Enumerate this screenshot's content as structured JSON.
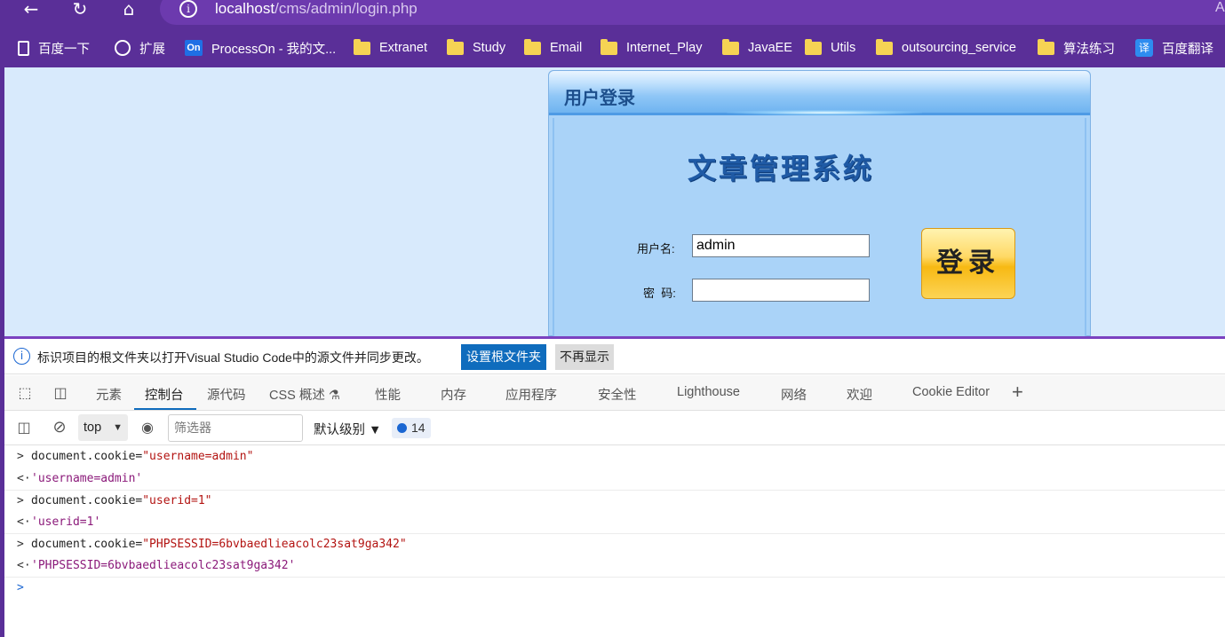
{
  "browser": {
    "url_host": "localhost",
    "url_path": "/cms/admin/login.php",
    "address_right_glyph": "A",
    "bookmarks": [
      {
        "label": "百度一下",
        "icon": "page-icon"
      },
      {
        "label": "扩展",
        "icon": "extensions-icon"
      },
      {
        "label": "ProcessOn - 我的文...",
        "icon": "processon-icon",
        "icon_text": "On"
      },
      {
        "label": "Extranet",
        "icon": "folder-icon"
      },
      {
        "label": "Study",
        "icon": "folder-icon"
      },
      {
        "label": "Email",
        "icon": "folder-icon"
      },
      {
        "label": "Internet_Play",
        "icon": "folder-icon"
      },
      {
        "label": "JavaEE",
        "icon": "folder-icon"
      },
      {
        "label": "Utils",
        "icon": "folder-icon"
      },
      {
        "label": "outsourcing_service",
        "icon": "folder-icon"
      },
      {
        "label": "算法练习",
        "icon": "folder-icon"
      },
      {
        "label": "百度翻译",
        "icon": "translate-icon",
        "icon_text": "译"
      }
    ]
  },
  "login_page": {
    "panel_title": "用户登录",
    "system_title": "文章管理系统",
    "username_label": "用户名:",
    "username_value": "admin",
    "password_label": "密  码:",
    "password_value": "",
    "login_button": "登录"
  },
  "devtools": {
    "infobar": {
      "text": "标识项目的根文件夹以打开Visual Studio Code中的源文件并同步更改。",
      "primary_button": "设置根文件夹",
      "secondary_button": "不再显示"
    },
    "tabs": [
      "元素",
      "控制台",
      "源代码",
      "CSS 概述 ⚗",
      "性能",
      "内存",
      "应用程序",
      "安全性",
      "Lighthouse",
      "网络",
      "欢迎",
      "Cookie Editor"
    ],
    "active_tab": "控制台",
    "add_tab_glyph": "+",
    "toolbar": {
      "context": "top",
      "filter_placeholder": "筛选器",
      "level": "默认级别 ▼",
      "message_count": "14"
    },
    "console": [
      {
        "type": "input",
        "code": "document.cookie=",
        "string": "\"username=admin\""
      },
      {
        "type": "output",
        "result": "'username=admin'"
      },
      {
        "type": "input",
        "code": "document.cookie=",
        "string": "\"userid=1\""
      },
      {
        "type": "output",
        "result": "'userid=1'"
      },
      {
        "type": "input",
        "code": "document.cookie=",
        "string": "\"PHPSESSID=6bvbaedlieacolc23sat9ga342\""
      },
      {
        "type": "output",
        "result": "'PHPSESSID=6bvbaedlieacolc23sat9ga342'"
      }
    ]
  }
}
